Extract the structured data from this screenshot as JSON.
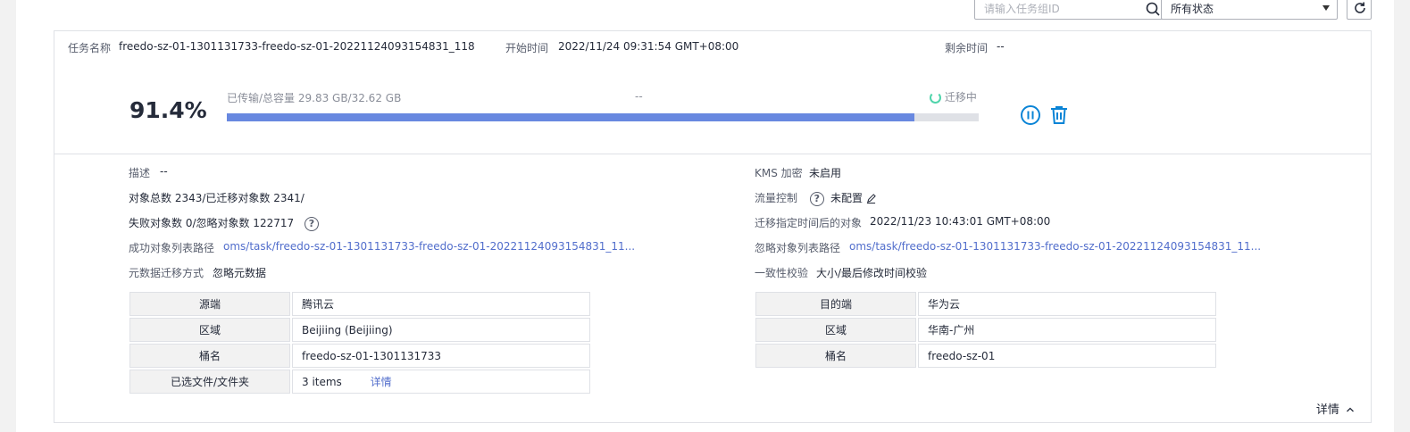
{
  "toolbar": {
    "search_placeholder": "请输入任务组ID",
    "status_select": "所有状态"
  },
  "task": {
    "name_label": "任务名称",
    "name_value": "freedo-sz-01-1301131733-freedo-sz-01-20221124093154831_118",
    "start_label": "开始时间",
    "start_value": "2022/11/24 09:31:54 GMT+08:00",
    "remaining_label": "剩余时间",
    "remaining_value": "--"
  },
  "progress": {
    "percent_text": "91.4%",
    "percent": 91.4,
    "transferred_text": "已传输/总容量 29.83 GB/32.62 GB",
    "speed_text": "--",
    "status_text": "迁移中"
  },
  "details_left": {
    "desc_label": "描述",
    "desc_value": "--",
    "objects_text": "对象总数 2343/已迁移对象数 2341/",
    "failed_text": "失败对象数 0/忽略对象数 122717",
    "success_path_label": "成功对象列表路径",
    "success_path_value": "oms/task/freedo-sz-01-1301131733-freedo-sz-01-20221124093154831_11...",
    "metadata_label": "元数据迁移方式",
    "metadata_value": "忽略元数据"
  },
  "details_right": {
    "kms_label": "KMS 加密",
    "kms_value": "未启用",
    "flow_label": "流量控制",
    "flow_value": "未配置",
    "after_time_label": "迁移指定时间后的对象",
    "after_time_value": "2022/11/23 10:43:01 GMT+08:00",
    "ignore_path_label": "忽略对象列表路径",
    "ignore_path_value": "oms/task/freedo-sz-01-1301131733-freedo-sz-01-20221124093154831_11...",
    "consistency_label": "一致性校验",
    "consistency_value": "大小/最后修改时间校验"
  },
  "source": {
    "end_label": "源端",
    "end_value": "腾讯云",
    "region_label": "区域",
    "region_value": "Beijiing (Beijiing)",
    "bucket_label": "桶名",
    "bucket_value": "freedo-sz-01-1301131733",
    "files_label": "已选文件/文件夹",
    "files_value": "3 items",
    "files_link": "详情"
  },
  "dest": {
    "end_label": "目的端",
    "end_value": "华为云",
    "region_label": "区域",
    "region_value": "华南-广州",
    "bucket_label": "桶名",
    "bucket_value": "freedo-sz-01"
  },
  "footer": {
    "details_toggle": "详情"
  },
  "colors": {
    "progress_fill": "#6888e0",
    "link": "#526ecc",
    "accent_icon": "#0a84d6",
    "status_spinner": "#50d4ab"
  },
  "icons": [
    "search-icon",
    "chevron-down-icon",
    "refresh-icon",
    "spinner-icon",
    "pause-icon",
    "trash-icon",
    "help-icon",
    "edit-icon",
    "chevron-up-icon"
  ]
}
